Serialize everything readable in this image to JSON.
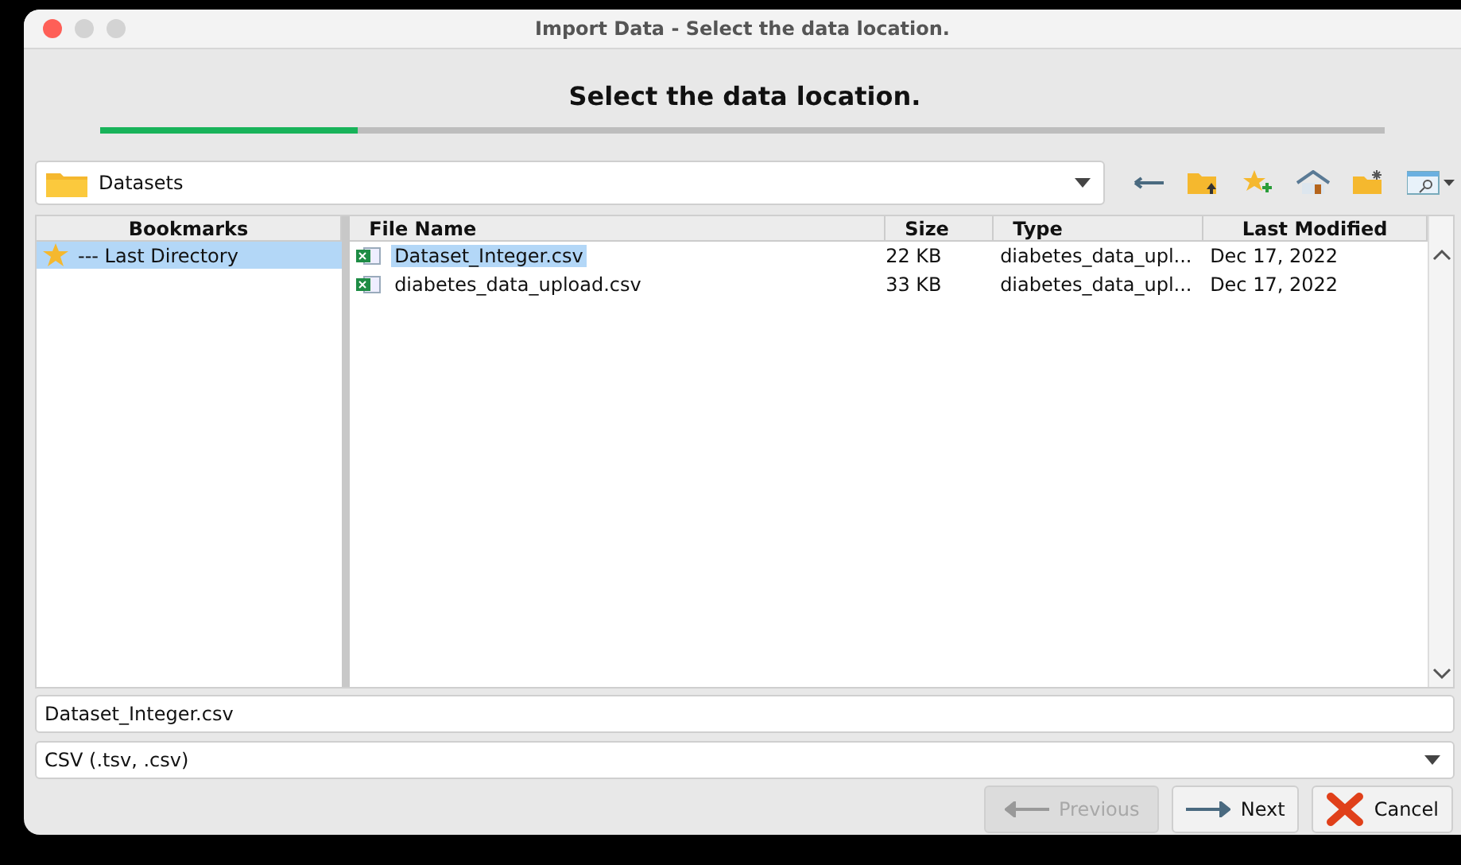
{
  "window": {
    "title": "Import Data - Select the data location."
  },
  "heading": "Select the data location.",
  "progress": {
    "level": 0.2
  },
  "location": {
    "value": "Datasets"
  },
  "bookmarks": {
    "header": "Bookmarks",
    "items": [
      {
        "label": "--- Last Directory",
        "selected": true
      }
    ]
  },
  "table": {
    "columns": [
      "File Name",
      "Size",
      "Type",
      "Last Modified"
    ],
    "rows": [
      {
        "cells": [
          "Dataset_Integer.csv",
          "22 KB",
          "diabetes_data_upl...",
          "Dec 17, 2022"
        ],
        "selected": true
      },
      {
        "cells": [
          "diabetes_data_upload.csv",
          "33 KB",
          "diabetes_data_upl...",
          "Dec 17, 2022"
        ],
        "selected": false
      }
    ]
  },
  "file_name": {
    "value": "Dataset_Integer.csv"
  },
  "filter": {
    "value": "CSV (.tsv, .csv)"
  },
  "buttons": [
    {
      "label": "Previous",
      "kind": "previous",
      "disabled": true
    },
    {
      "label": "Next",
      "kind": "next",
      "disabled": false
    },
    {
      "label": "Cancel",
      "kind": "cancel",
      "disabled": false
    }
  ]
}
